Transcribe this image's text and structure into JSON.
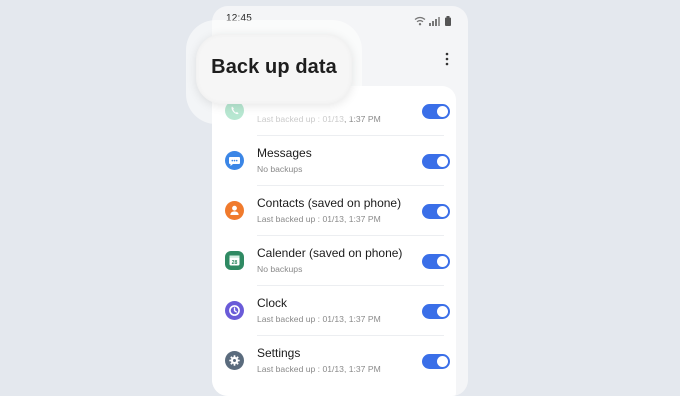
{
  "status_bar": {
    "time": "12:45",
    "icons": [
      "wifi-icon",
      "signal-icon",
      "battery-icon"
    ]
  },
  "header": {
    "title": "Back up data",
    "more_icon": "more-vert-icon"
  },
  "items": [
    {
      "title": "",
      "subtitle": "Last backed up : 01/13, 1:37 PM",
      "icon": "phone-icon",
      "icon_color": "#5fc99a",
      "enabled": true
    },
    {
      "title": "Messages",
      "subtitle": "No backups",
      "icon": "message-icon",
      "icon_color": "#3b86e6",
      "enabled": true
    },
    {
      "title": "Contacts (saved on phone)",
      "subtitle": "Last backed up : 01/13, 1:37 PM",
      "icon": "contact-icon",
      "icon_color": "#f07a2c",
      "enabled": true
    },
    {
      "title": "Calender (saved on phone)",
      "subtitle": "No backups",
      "icon": "calendar-icon",
      "icon_color": "#2f8a63",
      "icon_text": "28",
      "enabled": true
    },
    {
      "title": "Clock",
      "subtitle": "Last backed up : 01/13, 1:37 PM",
      "icon": "clock-icon",
      "icon_color": "#6a5bd8",
      "enabled": true
    },
    {
      "title": "Settings",
      "subtitle": "Last backed up : 01/13, 1:37 PM",
      "icon": "gear-icon",
      "icon_color": "#5a6b7d",
      "enabled": true
    }
  ],
  "colors": {
    "toggle_on": "#3a6fe8",
    "background": "#e4e8ee"
  }
}
